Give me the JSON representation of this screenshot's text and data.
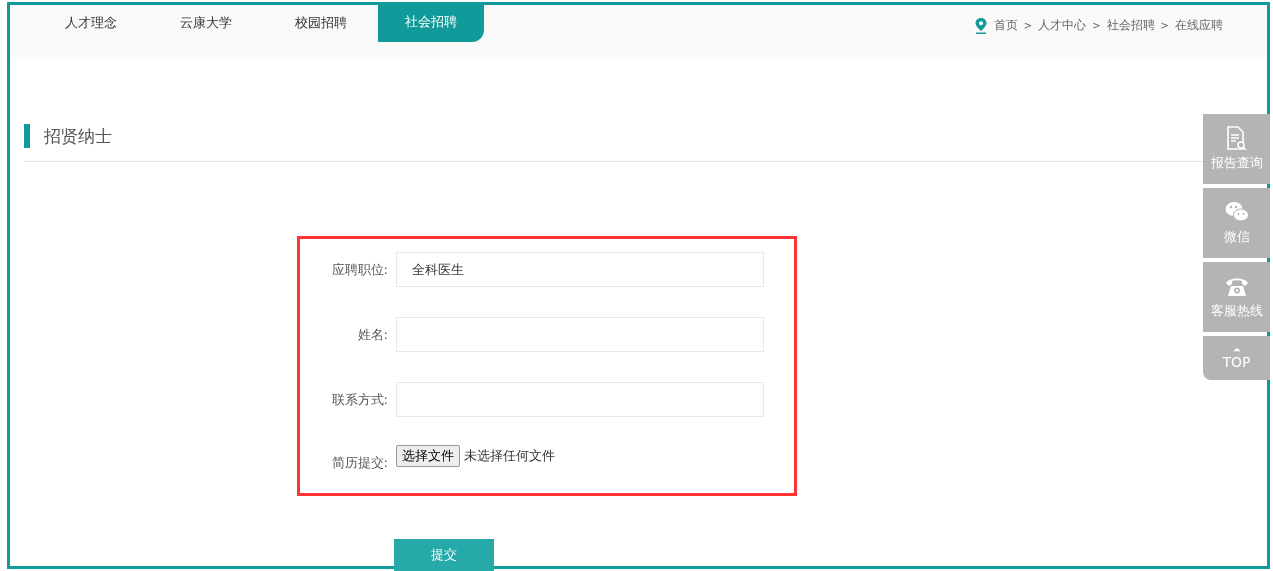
{
  "nav": {
    "tabs": [
      {
        "label": "人才理念",
        "selected": false
      },
      {
        "label": "云康大学",
        "selected": false
      },
      {
        "label": "校园招聘",
        "selected": false
      },
      {
        "label": "社会招聘",
        "selected": true
      }
    ]
  },
  "breadcrumb": {
    "separator": ">",
    "items": [
      "首页",
      "人才中心",
      "社会招聘",
      "在线应聘"
    ]
  },
  "section_title": "招贤纳士",
  "form": {
    "fields": [
      {
        "kind": "text",
        "label": "应聘职位:",
        "value": "全科医生"
      },
      {
        "kind": "text",
        "label": "姓名:"
      },
      {
        "kind": "text",
        "label": "联系方式:"
      },
      {
        "kind": "file",
        "label": "简历提交:",
        "button": "选择文件",
        "status": "未选择任何文件"
      }
    ],
    "submit": "提交"
  },
  "sidebar": [
    {
      "kind": "report",
      "label": "报告查询"
    },
    {
      "kind": "wechat",
      "label": "微信"
    },
    {
      "kind": "phone",
      "label": "客服热线"
    },
    {
      "kind": "top",
      "label": "TOP"
    }
  ]
}
